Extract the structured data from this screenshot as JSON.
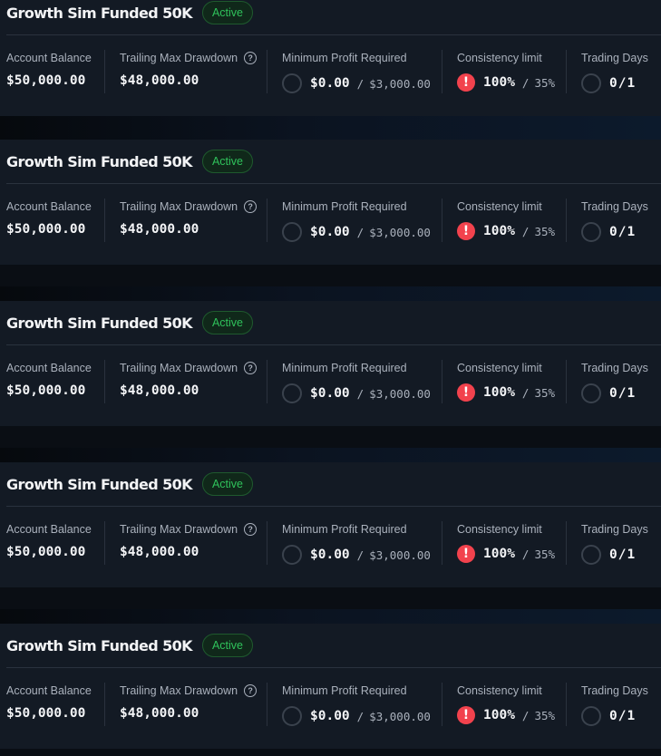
{
  "accounts": [
    {
      "name": "Growth Sim Funded 50K",
      "status": "Active",
      "account_balance": {
        "label": "Account Balance",
        "value": "$50,000.00"
      },
      "trailing_max_drawdown": {
        "label": "Trailing Max Drawdown",
        "value": "$48,000.00",
        "help_icon": "question-icon"
      },
      "minimum_profit": {
        "label": "Minimum Profit Required",
        "value": "$0.00",
        "target": "$3,000.00",
        "progress": 0
      },
      "consistency": {
        "label": "Consistency limit",
        "value": "100%",
        "target": "35%",
        "icon": "alert-icon",
        "icon_glyph": "!"
      },
      "trading_days": {
        "label": "Trading Days",
        "current": "0",
        "required": "1",
        "progress": 0
      }
    },
    {
      "name": "Growth Sim Funded 50K",
      "status": "Active",
      "account_balance": {
        "label": "Account Balance",
        "value": "$50,000.00"
      },
      "trailing_max_drawdown": {
        "label": "Trailing Max Drawdown",
        "value": "$48,000.00",
        "help_icon": "question-icon"
      },
      "minimum_profit": {
        "label": "Minimum Profit Required",
        "value": "$0.00",
        "target": "$3,000.00",
        "progress": 0
      },
      "consistency": {
        "label": "Consistency limit",
        "value": "100%",
        "target": "35%",
        "icon": "alert-icon",
        "icon_glyph": "!"
      },
      "trading_days": {
        "label": "Trading Days",
        "current": "0",
        "required": "1",
        "progress": 0
      }
    },
    {
      "name": "Growth Sim Funded 50K",
      "status": "Active",
      "account_balance": {
        "label": "Account Balance",
        "value": "$50,000.00"
      },
      "trailing_max_drawdown": {
        "label": "Trailing Max Drawdown",
        "value": "$48,000.00",
        "help_icon": "question-icon"
      },
      "minimum_profit": {
        "label": "Minimum Profit Required",
        "value": "$0.00",
        "target": "$3,000.00",
        "progress": 0
      },
      "consistency": {
        "label": "Consistency limit",
        "value": "100%",
        "target": "35%",
        "icon": "alert-icon",
        "icon_glyph": "!"
      },
      "trading_days": {
        "label": "Trading Days",
        "current": "0",
        "required": "1",
        "progress": 0
      }
    },
    {
      "name": "Growth Sim Funded 50K",
      "status": "Active",
      "account_balance": {
        "label": "Account Balance",
        "value": "$50,000.00"
      },
      "trailing_max_drawdown": {
        "label": "Trailing Max Drawdown",
        "value": "$48,000.00",
        "help_icon": "question-icon"
      },
      "minimum_profit": {
        "label": "Minimum Profit Required",
        "value": "$0.00",
        "target": "$3,000.00",
        "progress": 0
      },
      "consistency": {
        "label": "Consistency limit",
        "value": "100%",
        "target": "35%",
        "icon": "alert-icon",
        "icon_glyph": "!"
      },
      "trading_days": {
        "label": "Trading Days",
        "current": "0",
        "required": "1",
        "progress": 0
      }
    },
    {
      "name": "Growth Sim Funded 50K",
      "status": "Active",
      "account_balance": {
        "label": "Account Balance",
        "value": "$50,000.00"
      },
      "trailing_max_drawdown": {
        "label": "Trailing Max Drawdown",
        "value": "$48,000.00",
        "help_icon": "question-icon"
      },
      "minimum_profit": {
        "label": "Minimum Profit Required",
        "value": "$0.00",
        "target": "$3,000.00",
        "progress": 0
      },
      "consistency": {
        "label": "Consistency limit",
        "value": "100%",
        "target": "35%",
        "icon": "alert-icon",
        "icon_glyph": "!"
      },
      "trading_days": {
        "label": "Trading Days",
        "current": "0",
        "required": "1",
        "progress": 0
      }
    }
  ],
  "colors": {
    "card_background": "#131a24",
    "status_active": "#2fc25b",
    "alert": "#f2424d"
  }
}
